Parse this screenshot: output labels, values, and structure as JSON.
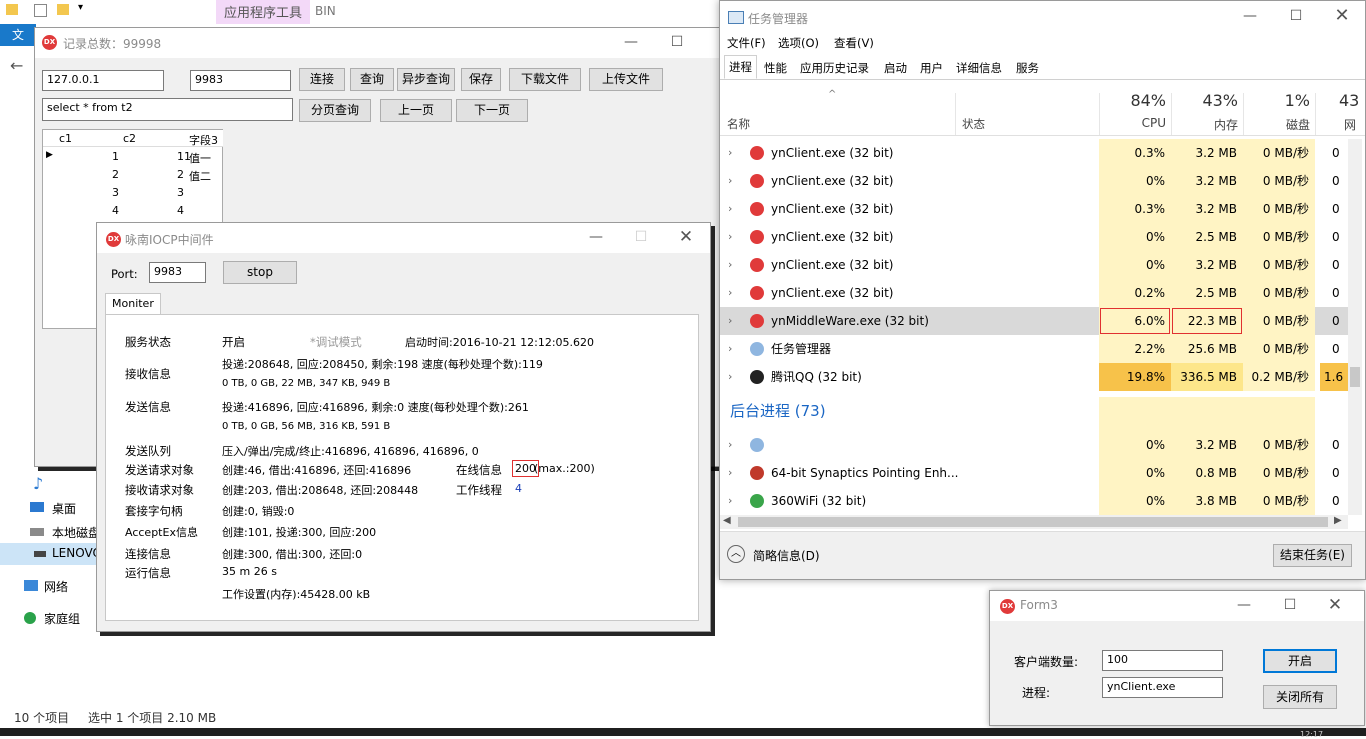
{
  "explorer": {
    "ribbon_tab": "应用程序工具",
    "ribbon_tab2": "BIN",
    "ribbon_file": "文",
    "sidebar": [
      {
        "label": "桌面",
        "icon": "desktop-icon"
      },
      {
        "label": "本地磁盘",
        "icon": "drive-icon"
      },
      {
        "label": "LENOVO",
        "icon": "drive-icon"
      },
      {
        "label": "网络",
        "icon": "network-icon"
      },
      {
        "label": "家庭组",
        "icon": "homegroup-icon"
      }
    ],
    "status_count": "10 个项目",
    "status_selected": "选中 1 个项目  2.10 MB"
  },
  "client_window": {
    "title": "记录总数：99998",
    "host": "127.0.0.1",
    "port": "9983",
    "sql": "select * from t2",
    "buttons": {
      "connect": "连接",
      "query": "查询",
      "async_query": "异步查询",
      "save": "保存",
      "download": "下载文件",
      "upload": "上传文件",
      "page_query": "分页查询",
      "prev": "上一页",
      "next": "下一页"
    },
    "grid": {
      "headers": [
        "c1",
        "c2",
        "字段3"
      ],
      "rows": [
        [
          "1",
          "11",
          "值一"
        ],
        [
          "2",
          "2",
          "值二"
        ],
        [
          "3",
          "3",
          ""
        ],
        [
          "4",
          "4",
          ""
        ]
      ]
    }
  },
  "middleware_window": {
    "title": "咏南IOCP中间件",
    "port_label": "Port:",
    "port": "9983",
    "stop": "stop",
    "tab": "Moniter",
    "service_label": "服务状态",
    "service_value": "开启",
    "debug": "*调试模式",
    "start_time": "启动时间:2016-10-21 12:12:05.620",
    "recv_label": "接收信息",
    "recv_line1": "投递:208648, 回应:208450, 剩余:198 速度(每秒处理个数):119",
    "recv_line2": "0 TB, 0 GB, 22 MB, 347 KB, 949 B",
    "send_label": "发送信息",
    "send_line1": "投递:416896, 回应:416896, 剩余:0 速度(每秒处理个数):261",
    "send_line2": "0 TB, 0 GB, 56 MB, 316 KB, 591 B",
    "queue_label": "发送队列",
    "queue_value": "压入/弹出/完成/终止:416896, 416896, 416896, 0",
    "send_req_label": "发送请求对象",
    "send_req_value": "创建:46, 借出:416896, 还回:416896",
    "online_label": "在线信息",
    "online_value": "200",
    "online_max": "(max.:200)",
    "recv_req_label": "接收请求对象",
    "recv_req_value": "创建:203, 借出:208648, 还回:208448",
    "worker_label": "工作线程",
    "worker_value": "4",
    "socket_label": "套接字句柄",
    "socket_value": "创建:0, 销毁:0",
    "acceptex_label": "AcceptEx信息",
    "acceptex_value": "创建:101, 投递:300, 回应:200",
    "conn_label": "连接信息",
    "conn_value": "创建:300, 借出:300, 还回:0",
    "run_label": "运行信息",
    "run_value": "35 m 26 s",
    "mem_value": "工作设置(内存):45428.00 kB"
  },
  "task_manager": {
    "title": "任务管理器",
    "menu": [
      "文件(F)",
      "选项(O)",
      "查看(V)"
    ],
    "tabs": [
      "进程",
      "性能",
      "应用历史记录",
      "启动",
      "用户",
      "详细信息",
      "服务"
    ],
    "col_name": "名称",
    "col_status": "状态",
    "cpu_pct": "84%",
    "cpu_label": "CPU",
    "mem_pct": "43%",
    "mem_label": "内存",
    "disk_pct": "1%",
    "disk_label": "磁盘",
    "net_pct": "43",
    "net_label": "网",
    "rows": [
      {
        "name": "ynClient.exe (32 bit)",
        "cpu": "0.3%",
        "mem": "3.2 MB",
        "disk": "0 MB/秒",
        "net": "0"
      },
      {
        "name": "ynClient.exe (32 bit)",
        "cpu": "0%",
        "mem": "3.2 MB",
        "disk": "0 MB/秒",
        "net": "0"
      },
      {
        "name": "ynClient.exe (32 bit)",
        "cpu": "0.3%",
        "mem": "3.2 MB",
        "disk": "0 MB/秒",
        "net": "0"
      },
      {
        "name": "ynClient.exe (32 bit)",
        "cpu": "0%",
        "mem": "2.5 MB",
        "disk": "0 MB/秒",
        "net": "0"
      },
      {
        "name": "ynClient.exe (32 bit)",
        "cpu": "0%",
        "mem": "3.2 MB",
        "disk": "0 MB/秒",
        "net": "0"
      },
      {
        "name": "ynClient.exe (32 bit)",
        "cpu": "0.2%",
        "mem": "2.5 MB",
        "disk": "0 MB/秒",
        "net": "0"
      },
      {
        "name": "ynMiddleWare.exe (32 bit)",
        "cpu": "6.0%",
        "mem": "22.3 MB",
        "disk": "0 MB/秒",
        "net": "0"
      },
      {
        "name": "任务管理器",
        "cpu": "2.2%",
        "mem": "25.6 MB",
        "disk": "0 MB/秒",
        "net": "0"
      },
      {
        "name": "腾讯QQ (32 bit)",
        "cpu": "19.8%",
        "mem": "336.5 MB",
        "disk": "0.2 MB/秒",
        "net": "1.6"
      }
    ],
    "bg_section": "后台进程 (73)",
    "bg_rows": [
      {
        "name": "",
        "cpu": "0%",
        "mem": "3.2 MB",
        "disk": "0 MB/秒",
        "net": "0"
      },
      {
        "name": "64-bit Synaptics Pointing Enh...",
        "cpu": "0%",
        "mem": "0.8 MB",
        "disk": "0 MB/秒",
        "net": "0"
      },
      {
        "name": "360WiFi (32 bit)",
        "cpu": "0%",
        "mem": "3.8 MB",
        "disk": "0 MB/秒",
        "net": "0"
      }
    ],
    "less_details": "简略信息(D)",
    "end_task": "结束任务(E)"
  },
  "form3": {
    "title": "Form3",
    "client_count_label": "客户端数量:",
    "client_count": "100",
    "process_label": "进程:",
    "process": "ynClient.exe",
    "start": "开启",
    "close_all": "关闭所有"
  },
  "taskbar": {
    "clock": "12:17"
  }
}
